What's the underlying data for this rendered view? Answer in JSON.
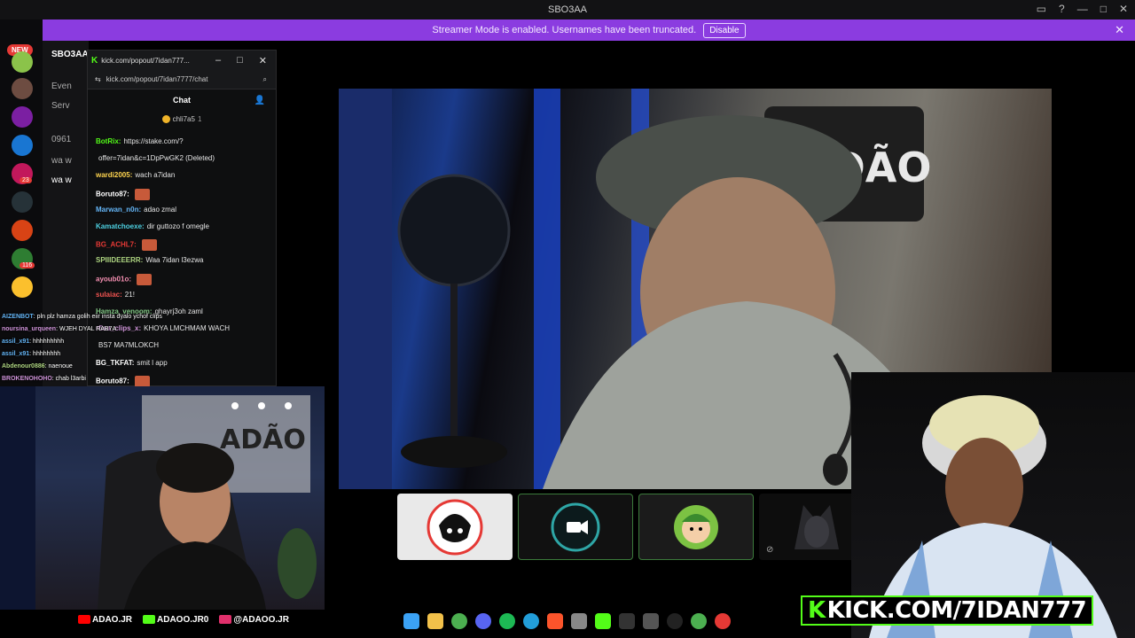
{
  "window": {
    "title": "SBO3AA"
  },
  "banner": {
    "text": "Streamer Mode is enabled. Usernames have been truncated.",
    "button": "Disable"
  },
  "rail": {
    "new_badge": "NEW",
    "badges": [
      "23",
      "1",
      "116"
    ]
  },
  "discord_sidebar": {
    "server_name": "SBO3AA",
    "items": [
      "Even",
      "Serv",
      "0961",
      "wa w",
      "wa w"
    ]
  },
  "popout": {
    "tab_title": "kick.com/popout/7idan777...",
    "url": "kick.com/popout/7idan7777/chat",
    "chat_title": "Chat",
    "pinned_user": "chli7a5",
    "pinned_count": "1",
    "messages": [
      {
        "user": "BotRix:",
        "text": "https://stake.com/?",
        "color": "#53fc18"
      },
      {
        "user": "",
        "text": "offer=7idan&c=1DpPwGK2 (Deleted)",
        "color": "#fff"
      },
      {
        "user": "wardi2005:",
        "text": "wach a7idan",
        "color": "#ffd54f"
      },
      {
        "user": "Boruto87:",
        "text": "",
        "color": "#fff"
      },
      {
        "user": "Marwan_n0n:",
        "text": "adao zmal",
        "color": "#64b5f6"
      },
      {
        "user": "Kamatchoexe:",
        "text": "dir guttozo f omegle",
        "color": "#4dd0e1"
      },
      {
        "user": "BG_ACHL7:",
        "text": "",
        "color": "#e53935"
      },
      {
        "user": "SPIIIDEEERR:",
        "text": "Waa 7idan l3ezwa",
        "color": "#aed581"
      },
      {
        "user": "ayoub01o:",
        "text": "",
        "color": "#f48fb1"
      },
      {
        "user": "sulaiac:",
        "text": "21!",
        "color": "#ef5350"
      },
      {
        "user": "Hamza_venoom:",
        "text": "ghayrj3oh zaml",
        "color": "#81c784"
      },
      {
        "user": "rfisa_clips_x:",
        "text": "KHOYA LMCHMAM WACH",
        "color": "#ce93d8"
      },
      {
        "user": "",
        "text": "BS7 MA7MLOKCH",
        "color": "#fff"
      },
      {
        "user": "BG_TKFAT:",
        "text": "smit l app",
        "color": "#ffffff"
      },
      {
        "user": "Boruto87:",
        "text": "",
        "color": "#fff"
      }
    ]
  },
  "overlay_chat": [
    {
      "user": "AIZENBOT",
      "text": ": pln plz hamza golih eiir insta dyalo ychof clips",
      "color": "#64b5f6"
    },
    {
      "user": "noursina_urqueen",
      "text": ": WJEH DYAL RAB7A",
      "color": "#ce93d8"
    },
    {
      "user": "assil_x91",
      "text": ": hhhhhhhhh",
      "color": "#64b5f6"
    },
    {
      "user": "assil_x91",
      "text": ": hhhhhhhh",
      "color": "#64b5f6"
    },
    {
      "user": "Abdenour0886",
      "text": ": naenoue",
      "color": "#aed581"
    },
    {
      "user": "BROKENOHOHO",
      "text": ": chab l3arbi",
      "color": "#ce93d8"
    }
  ],
  "socials": [
    {
      "label": "ADAO.JR",
      "icon": "youtube-icon",
      "color": "#ff0000"
    },
    {
      "label": "ADAOO.JR0",
      "icon": "kick-icon",
      "color": "#53fc18"
    },
    {
      "label": "@ADAOO.JR",
      "icon": "instagram-icon",
      "color": "#e1306c"
    }
  ],
  "kick_overlay": {
    "k": "K",
    "text": "KICK.COM/7IDAN777"
  },
  "colors": {
    "accent": "#8b3ce0",
    "kick": "#53fc18"
  }
}
